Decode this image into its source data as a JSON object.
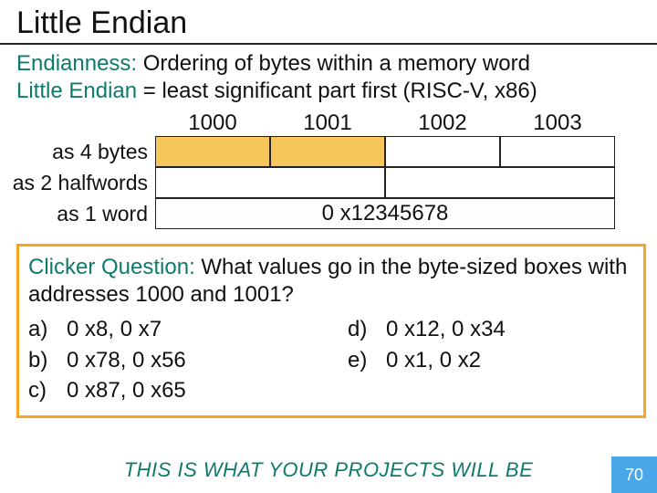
{
  "title": "Little Endian",
  "subtitle": {
    "endianness_label": "Endianness:",
    "endianness_text": " Ordering of bytes within a memory word",
    "le_label": "Little Endian",
    "le_text": " = least significant part first (RISC-V, x86)"
  },
  "addresses": [
    "1000",
    "1001",
    "1002",
    "1003"
  ],
  "row_labels": {
    "bytes": "as 4 bytes",
    "halfwords": "as 2 halfwords",
    "word": "as 1 word"
  },
  "word_value": "0 x12345678",
  "clicker": {
    "label": "Clicker Question:",
    "question": " What values go in the byte-sized boxes with addresses 1000 and 1001?",
    "answers_left": [
      {
        "letter": "a)",
        "text": "0 x8, 0 x7"
      },
      {
        "letter": "b)",
        "text": "0 x78, 0 x56"
      },
      {
        "letter": "c)",
        "text": "0 x87, 0 x65"
      }
    ],
    "answers_right": [
      {
        "letter": "d)",
        "text": "0 x12, 0 x34"
      },
      {
        "letter": "e)",
        "text": "0 x1, 0 x2"
      }
    ]
  },
  "footer": "THIS IS WHAT YOUR PROJECTS WILL BE",
  "page": "70"
}
